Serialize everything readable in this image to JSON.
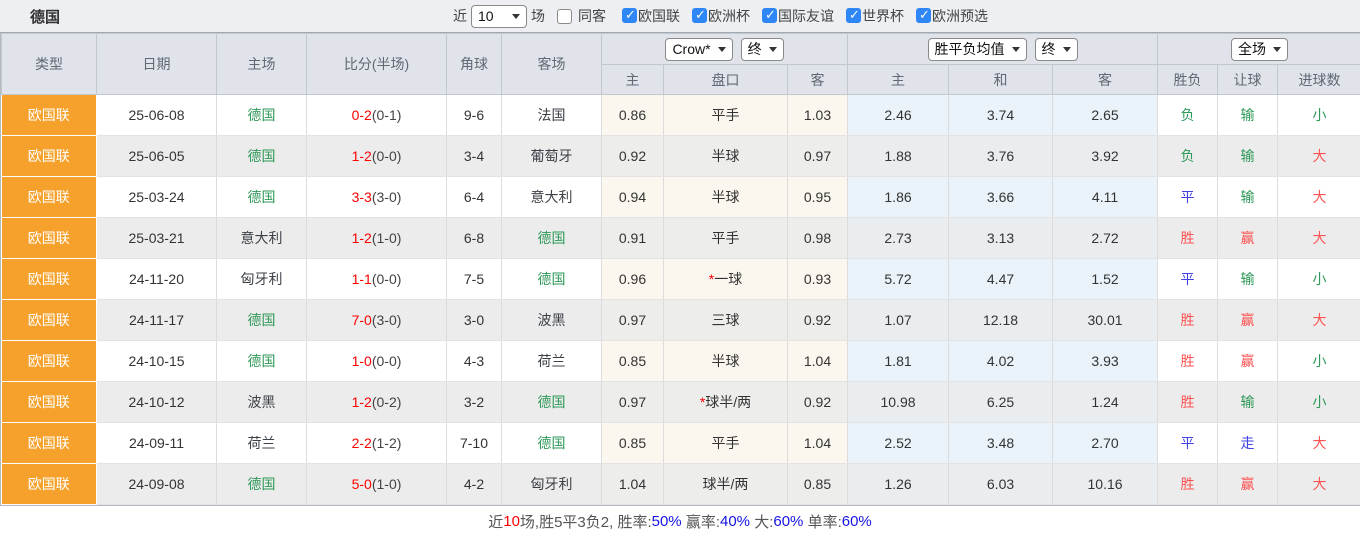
{
  "topbar": {
    "title": "德国",
    "recent_label": "近",
    "recent_value": "10",
    "matches_label": "场",
    "same_venue_label": "同客",
    "competitions": [
      {
        "label": "欧国联",
        "checked": true
      },
      {
        "label": "欧洲杯",
        "checked": true
      },
      {
        "label": "国际友谊",
        "checked": true
      },
      {
        "label": "世界杯",
        "checked": true
      },
      {
        "label": "欧洲预选",
        "checked": true
      }
    ]
  },
  "table": {
    "columns": {
      "type": "类型",
      "date": "日期",
      "home": "主场",
      "score": "比分(半场)",
      "corners": "角球",
      "away": "客场"
    },
    "group_selects": {
      "crown": "Crow*",
      "crown_final": "终",
      "avg": "胜平负均值",
      "avg_final": "终",
      "scope": "全场"
    },
    "sub_headers": {
      "crown_home": "主",
      "handicap": "盘口",
      "crown_away": "客",
      "avg_home": "主",
      "avg_draw": "和",
      "avg_away": "客",
      "result": "胜负",
      "handicap_result": "让球",
      "goals": "进球数"
    },
    "rows": [
      {
        "type": "欧国联",
        "date": "25-06-08",
        "home": {
          "name": "德国",
          "subject": true
        },
        "score": {
          "full_time": "0-2",
          "half_time": "(0-1)"
        },
        "corners": "9-6",
        "away": {
          "name": "法国",
          "subject": false
        },
        "crown": {
          "home": "0.86",
          "handicap": "平手",
          "star": false,
          "away": "1.03"
        },
        "avg": {
          "home": "2.46",
          "draw": "3.74",
          "away": "2.65"
        },
        "result": {
          "text": "负",
          "color": "green"
        },
        "handicap_result": {
          "text": "输",
          "color": "green"
        },
        "goals": {
          "text": "小",
          "color": "green"
        }
      },
      {
        "type": "欧国联",
        "date": "25-06-05",
        "home": {
          "name": "德国",
          "subject": true
        },
        "score": {
          "full_time": "1-2",
          "half_time": "(0-0)"
        },
        "corners": "3-4",
        "away": {
          "name": "葡萄牙",
          "subject": false
        },
        "crown": {
          "home": "0.92",
          "handicap": "半球",
          "star": false,
          "away": "0.97"
        },
        "avg": {
          "home": "1.88",
          "draw": "3.76",
          "away": "3.92"
        },
        "result": {
          "text": "负",
          "color": "green"
        },
        "handicap_result": {
          "text": "输",
          "color": "green"
        },
        "goals": {
          "text": "大",
          "color": "red"
        }
      },
      {
        "type": "欧国联",
        "date": "25-03-24",
        "home": {
          "name": "德国",
          "subject": true
        },
        "score": {
          "full_time": "3-3",
          "half_time": "(3-0)"
        },
        "corners": "6-4",
        "away": {
          "name": "意大利",
          "subject": false
        },
        "crown": {
          "home": "0.94",
          "handicap": "半球",
          "star": false,
          "away": "0.95"
        },
        "avg": {
          "home": "1.86",
          "draw": "3.66",
          "away": "4.11"
        },
        "result": {
          "text": "平",
          "color": "blue"
        },
        "handicap_result": {
          "text": "输",
          "color": "green"
        },
        "goals": {
          "text": "大",
          "color": "red"
        }
      },
      {
        "type": "欧国联",
        "date": "25-03-21",
        "home": {
          "name": "意大利",
          "subject": false
        },
        "score": {
          "full_time": "1-2",
          "half_time": "(1-0)"
        },
        "corners": "6-8",
        "away": {
          "name": "德国",
          "subject": true
        },
        "crown": {
          "home": "0.91",
          "handicap": "平手",
          "star": false,
          "away": "0.98"
        },
        "avg": {
          "home": "2.73",
          "draw": "3.13",
          "away": "2.72"
        },
        "result": {
          "text": "胜",
          "color": "red"
        },
        "handicap_result": {
          "text": "赢",
          "color": "red"
        },
        "goals": {
          "text": "大",
          "color": "red"
        }
      },
      {
        "type": "欧国联",
        "date": "24-11-20",
        "home": {
          "name": "匈牙利",
          "subject": false
        },
        "score": {
          "full_time": "1-1",
          "half_time": "(0-0)"
        },
        "corners": "7-5",
        "away": {
          "name": "德国",
          "subject": true
        },
        "crown": {
          "home": "0.96",
          "handicap": "一球",
          "star": true,
          "away": "0.93"
        },
        "avg": {
          "home": "5.72",
          "draw": "4.47",
          "away": "1.52"
        },
        "result": {
          "text": "平",
          "color": "blue"
        },
        "handicap_result": {
          "text": "输",
          "color": "green"
        },
        "goals": {
          "text": "小",
          "color": "green"
        }
      },
      {
        "type": "欧国联",
        "date": "24-11-17",
        "home": {
          "name": "德国",
          "subject": true
        },
        "score": {
          "full_time": "7-0",
          "half_time": "(3-0)"
        },
        "corners": "3-0",
        "away": {
          "name": "波黑",
          "subject": false
        },
        "crown": {
          "home": "0.97",
          "handicap": "三球",
          "star": false,
          "away": "0.92"
        },
        "avg": {
          "home": "1.07",
          "draw": "12.18",
          "away": "30.01"
        },
        "result": {
          "text": "胜",
          "color": "red"
        },
        "handicap_result": {
          "text": "赢",
          "color": "red"
        },
        "goals": {
          "text": "大",
          "color": "red"
        }
      },
      {
        "type": "欧国联",
        "date": "24-10-15",
        "home": {
          "name": "德国",
          "subject": true
        },
        "score": {
          "full_time": "1-0",
          "half_time": "(0-0)"
        },
        "corners": "4-3",
        "away": {
          "name": "荷兰",
          "subject": false
        },
        "crown": {
          "home": "0.85",
          "handicap": "半球",
          "star": false,
          "away": "1.04"
        },
        "avg": {
          "home": "1.81",
          "draw": "4.02",
          "away": "3.93"
        },
        "result": {
          "text": "胜",
          "color": "red"
        },
        "handicap_result": {
          "text": "赢",
          "color": "red"
        },
        "goals": {
          "text": "小",
          "color": "green"
        }
      },
      {
        "type": "欧国联",
        "date": "24-10-12",
        "home": {
          "name": "波黑",
          "subject": false
        },
        "score": {
          "full_time": "1-2",
          "half_time": "(0-2)"
        },
        "corners": "3-2",
        "away": {
          "name": "德国",
          "subject": true
        },
        "crown": {
          "home": "0.97",
          "handicap": "球半/两",
          "star": true,
          "away": "0.92"
        },
        "avg": {
          "home": "10.98",
          "draw": "6.25",
          "away": "1.24"
        },
        "result": {
          "text": "胜",
          "color": "red"
        },
        "handicap_result": {
          "text": "输",
          "color": "green"
        },
        "goals": {
          "text": "小",
          "color": "green"
        }
      },
      {
        "type": "欧国联",
        "date": "24-09-11",
        "home": {
          "name": "荷兰",
          "subject": false
        },
        "score": {
          "full_time": "2-2",
          "half_time": "(1-2)"
        },
        "corners": "7-10",
        "away": {
          "name": "德国",
          "subject": true
        },
        "crown": {
          "home": "0.85",
          "handicap": "平手",
          "star": false,
          "away": "1.04"
        },
        "avg": {
          "home": "2.52",
          "draw": "3.48",
          "away": "2.70"
        },
        "result": {
          "text": "平",
          "color": "blue"
        },
        "handicap_result": {
          "text": "走",
          "color": "blue"
        },
        "goals": {
          "text": "大",
          "color": "red"
        }
      },
      {
        "type": "欧国联",
        "date": "24-09-08",
        "home": {
          "name": "德国",
          "subject": true
        },
        "score": {
          "full_time": "5-0",
          "half_time": "(1-0)"
        },
        "corners": "4-2",
        "away": {
          "name": "匈牙利",
          "subject": false
        },
        "crown": {
          "home": "1.04",
          "handicap": "球半/两",
          "star": false,
          "away": "0.85"
        },
        "avg": {
          "home": "1.26",
          "draw": "6.03",
          "away": "10.16"
        },
        "result": {
          "text": "胜",
          "color": "red"
        },
        "handicap_result": {
          "text": "赢",
          "color": "red"
        },
        "goals": {
          "text": "大",
          "color": "red"
        }
      }
    ]
  },
  "footer": {
    "prefix": "近",
    "count": "10",
    "middle": "场,胜5平3负2, 胜率:",
    "win_rate": "50%",
    "label_handicap": " 赢率:",
    "handicap_rate": "40%",
    "label_big": " 大:",
    "big_rate": "60%",
    "label_odd": " 单率:",
    "odd_rate": "60%"
  },
  "colors": {
    "red": "#ff5252",
    "green": "#2e9958",
    "blue": "#4242e4",
    "type_orange": "#f6a12b",
    "subject_team_green": "#2e9958",
    "score_red": "#ff0000",
    "footer_value_blue": "#1414e6"
  }
}
